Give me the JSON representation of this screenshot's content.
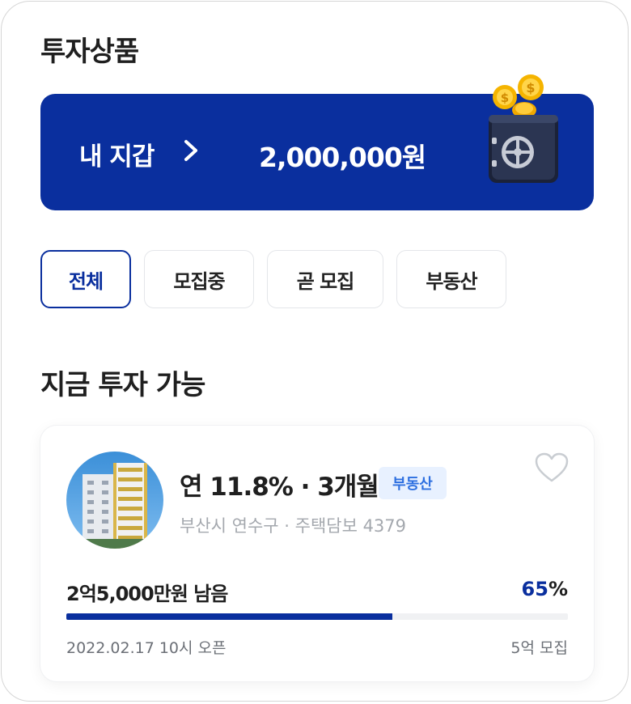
{
  "header": {
    "title": "투자상품"
  },
  "wallet": {
    "label": "내 지갑",
    "amount": "2,000,000원",
    "background_color": "#0a2f9e",
    "chevron_icon": "chevron-right-icon",
    "illustration": "safe-with-coins-icon"
  },
  "tabs": [
    {
      "label": "전체",
      "active": true
    },
    {
      "label": "모집중",
      "active": false
    },
    {
      "label": "곧 모집",
      "active": false
    },
    {
      "label": "부동산",
      "active": false
    }
  ],
  "section": {
    "title": "지금 투자 가능"
  },
  "product": {
    "rate_text": "연 11.8% · 3개월",
    "category_badge": "부동산",
    "location": "부산시 연수구 · 주택담보 4379",
    "remaining": "2억5,000만원 남음",
    "progress_percent_number": "65",
    "progress_percent_sign": "%",
    "progress_value": 0.65,
    "open_date": "2022.02.17  10시 오픈",
    "target_amount": "5억 모집",
    "favorite_icon": "heart-outline-icon",
    "thumbnail": "apartment-building-image",
    "accent_color": "#0a2f9e",
    "badge_color": "#2d6fe0"
  }
}
